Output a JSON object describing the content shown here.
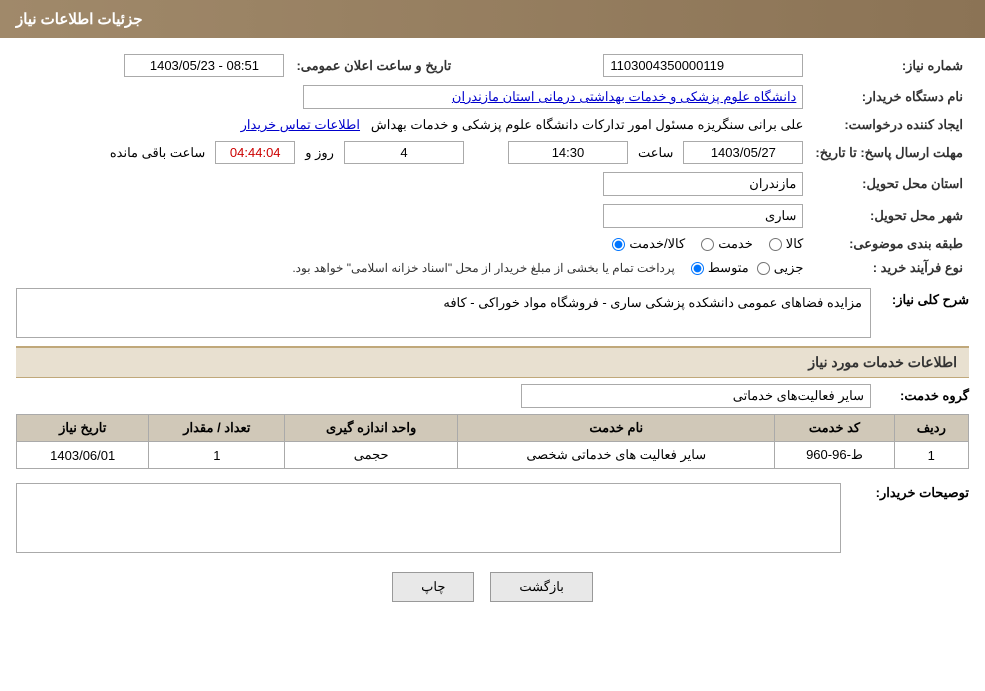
{
  "header": {
    "title": "جزئیات اطلاعات نیاز"
  },
  "fields": {
    "shomareNiaz_label": "شماره نیاز:",
    "shomareNiaz_value": "1103004350000119",
    "namDastgah_label": "نام دستگاه خریدار:",
    "namDastgah_value": "دانشگاه علوم پزشکی و خدمات بهداشتی  درمانی استان مازندران",
    "ijadKonande_label": "ایجاد کننده درخواست:",
    "ijadKonande_value": "علی برانی سنگریزه مسئول امور تدارکات دانشگاه علوم پزشکی و خدمات بهداش",
    "contactLink": "اطلاعات تماس خریدار",
    "mohlat_label": "مهلت ارسال پاسخ: تا تاریخ:",
    "mohlat_date": "1403/05/27",
    "mohlat_time": "14:30",
    "mohlat_days": "4",
    "mohlat_countdown": "04:44:04",
    "mohlat_remaining": "ساعت باقی مانده",
    "mohlat_days_label": "روز و",
    "tarikh_label": "تاریخ و ساعت اعلان عمومی:",
    "tarikh_value": "1403/05/23 - 08:51",
    "ostan_label": "استان محل تحویل:",
    "ostan_value": "مازندران",
    "shahr_label": "شهر محل تحویل:",
    "shahr_value": "ساری",
    "tabaqe_label": "طبقه بندی موضوعی:",
    "tabaqe_kala": "کالا",
    "tabaqe_khadamat": "خدمت",
    "tabaqe_kala_khadamat": "کالا/خدمت",
    "noeFarayand_label": "نوع فرآیند خرید :",
    "noeFarayand_jozei": "جزیی",
    "noeFarayand_mottaset": "متوسط",
    "noeFarayand_note": "پرداخت تمام یا بخشی از مبلغ خریدار از محل \"اسناد خزانه اسلامی\" خواهد بود.",
    "sharhKoli_label": "شرح کلی نیاز:",
    "sharhKoli_value": "مزایده فضاهای عمومی دانشکده پزشکی ساری - فروشگاه مواد خوراکی - کافه",
    "khadamatInfo_title": "اطلاعات خدمات مورد نیاز",
    "garohKhadamat_label": "گروه خدمت:",
    "garohKhadamat_value": "سایر فعالیت‌های خدماتی",
    "table": {
      "headers": [
        "ردیف",
        "کد خدمت",
        "نام خدمت",
        "واحد اندازه گیری",
        "تعداد / مقدار",
        "تاریخ نیاز"
      ],
      "rows": [
        {
          "radif": "1",
          "kodKhadamat": "ط-96-960",
          "namKhadamat": "سایر فعالیت های خدماتی شخصی",
          "vahed": "حجمی",
          "tedad": "1",
          "tarikh": "1403/06/01"
        }
      ]
    },
    "tosifKharidar_label": "توصیحات خریدار:"
  },
  "buttons": {
    "print": "چاپ",
    "back": "بازگشت"
  }
}
